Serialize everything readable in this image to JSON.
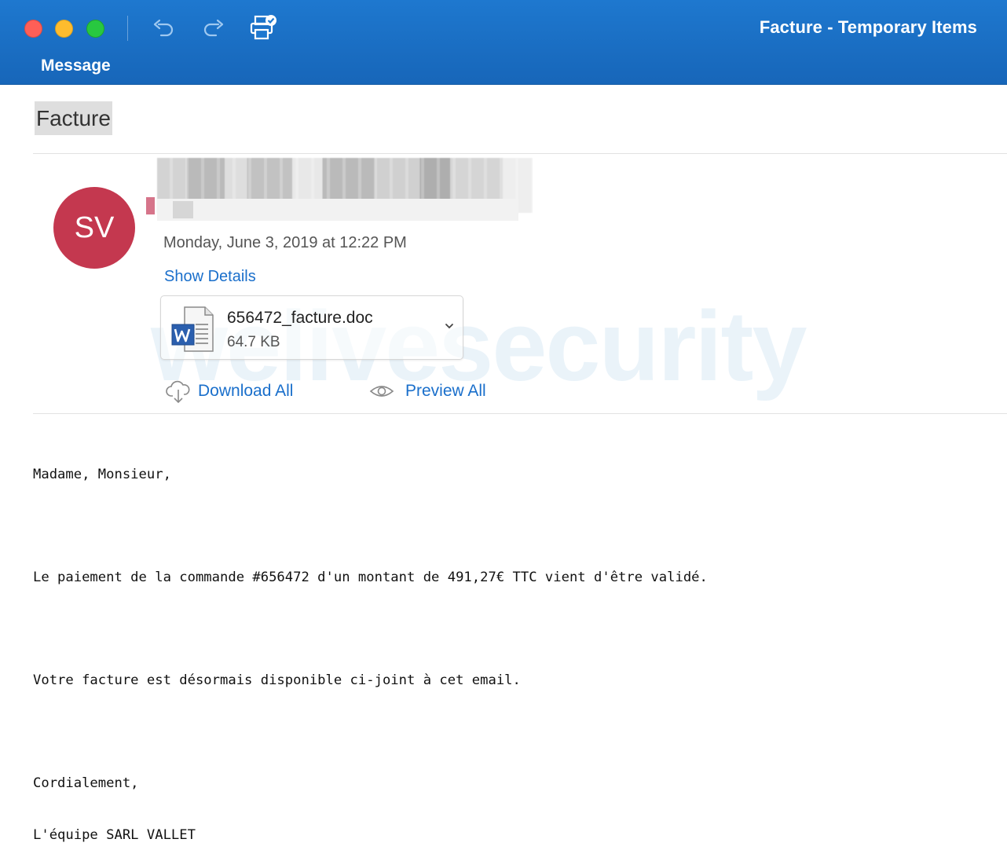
{
  "window": {
    "title": "Facture - Temporary Items",
    "tab": "Message",
    "toolbar": {
      "undo_icon": "undo-icon",
      "redo_icon": "redo-icon",
      "print_icon": "print-icon"
    }
  },
  "message": {
    "subject": "Facture",
    "sender_initials": "SV",
    "date": "Monday, June 3, 2019 at 12:22 PM",
    "show_details": "Show Details",
    "attachment": {
      "name": "656472_facture.doc",
      "size": "64.7 KB",
      "icon": "word-doc-icon"
    },
    "actions": {
      "download_all": "Download All",
      "preview_all": "Preview All"
    },
    "body": [
      "Madame, Monsieur,",
      "Le paiement de la commande #656472 d'un montant de 491,27€ TTC vient d'être validé.",
      "Votre facture est désormais disponible ci-joint à cet email.",
      "Cordialement,",
      "L'équipe SARL VALLET"
    ]
  },
  "watermark": "welivesecurity",
  "colors": {
    "ribbon": "#1e78cf",
    "avatar": "#c4384f",
    "link": "#1a6fcb",
    "subject_highlight": "#dedede"
  }
}
